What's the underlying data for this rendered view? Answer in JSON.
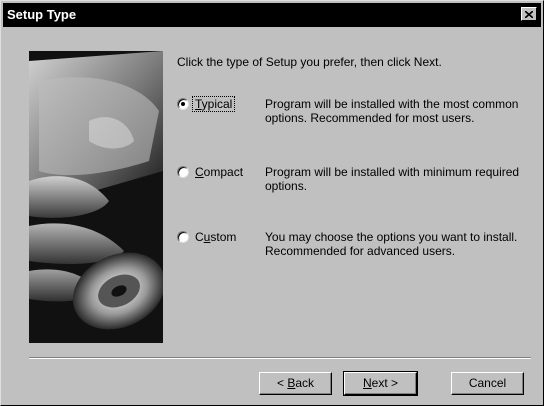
{
  "window": {
    "title": "Setup Type",
    "close_glyph": "✕"
  },
  "main": {
    "instructions": "Click the type of Setup you prefer, then click Next.",
    "options": [
      {
        "label_prefix": "",
        "label_mnemonic": "T",
        "label_rest": "ypical",
        "description_line1": "Program will be installed with the most common",
        "description_line2": "options.  Recommended for most users.",
        "selected": true
      },
      {
        "label_prefix": "",
        "label_mnemonic": "C",
        "label_rest": "ompact",
        "description_line1": "Program will be installed with minimum required",
        "description_line2": "options.",
        "selected": false
      },
      {
        "label_prefix": "C",
        "label_mnemonic": "u",
        "label_rest": "stom",
        "description_line1": "You may choose the options you want to install.",
        "description_line2": "Recommended for advanced users.",
        "selected": false
      }
    ]
  },
  "buttons": {
    "back_prefix": "< ",
    "back_mnemonic": "B",
    "back_rest": "ack",
    "next_mnemonic": "N",
    "next_rest": "ext >",
    "cancel": "Cancel"
  },
  "icons": {
    "close": "close-icon",
    "artwork": "setup-artwork-image"
  }
}
